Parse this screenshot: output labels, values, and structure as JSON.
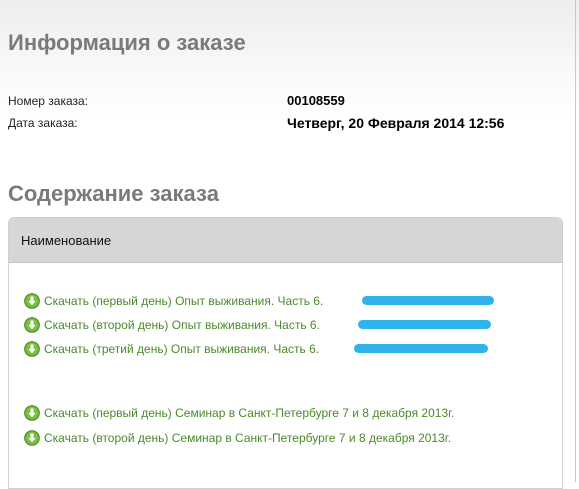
{
  "order_info": {
    "title": "Информация о заказе",
    "order_number_label": "Номер заказа:",
    "order_number": "00108559",
    "order_date_label": "Дата заказа:",
    "order_date": "Четверг, 20 Февраля 2014 12:56"
  },
  "order_content": {
    "title": "Содержание заказа",
    "column_header": "Наименование",
    "items": [
      {
        "label": "Скачать (первый день) Опыт выживания. Часть 6."
      },
      {
        "label": "Скачать (второй день) Опыт выживания. Часть 6."
      },
      {
        "label": "Скачать (третий день) Опыт выживания. Часть 6."
      },
      {
        "label": "Скачать (первый день) Семинар в Санкт-Петербурге 7 и 8 декабря 2013г."
      },
      {
        "label": "Скачать (второй день) Семинар в Санкт-Петербурге 7 и 8 декабря 2013г."
      }
    ]
  },
  "colors": {
    "link": "#4b8a2a",
    "heading": "#7a7a7a",
    "redaction": "#2fb3ea"
  },
  "icons": {
    "download": "download-arrow-circle-icon"
  }
}
